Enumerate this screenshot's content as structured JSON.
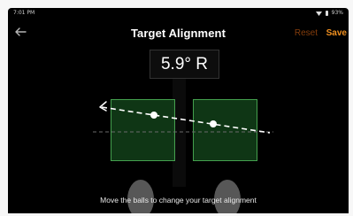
{
  "status_bar": {
    "time": "7:01 PM",
    "battery": "93%"
  },
  "app_bar": {
    "title": "Target Alignment",
    "reset_label": "Reset",
    "save_label": "Save",
    "back_icon": "back-arrow-icon"
  },
  "alignment": {
    "angle_readout": "5.9° R"
  },
  "instruction": "Move the balls to change your target alignment",
  "colors": {
    "background": "#000000",
    "box_border": "#44a04e",
    "box_fill": "#1c6226",
    "save": "#f09020",
    "reset": "#843d0c",
    "line": "#ffffff"
  }
}
